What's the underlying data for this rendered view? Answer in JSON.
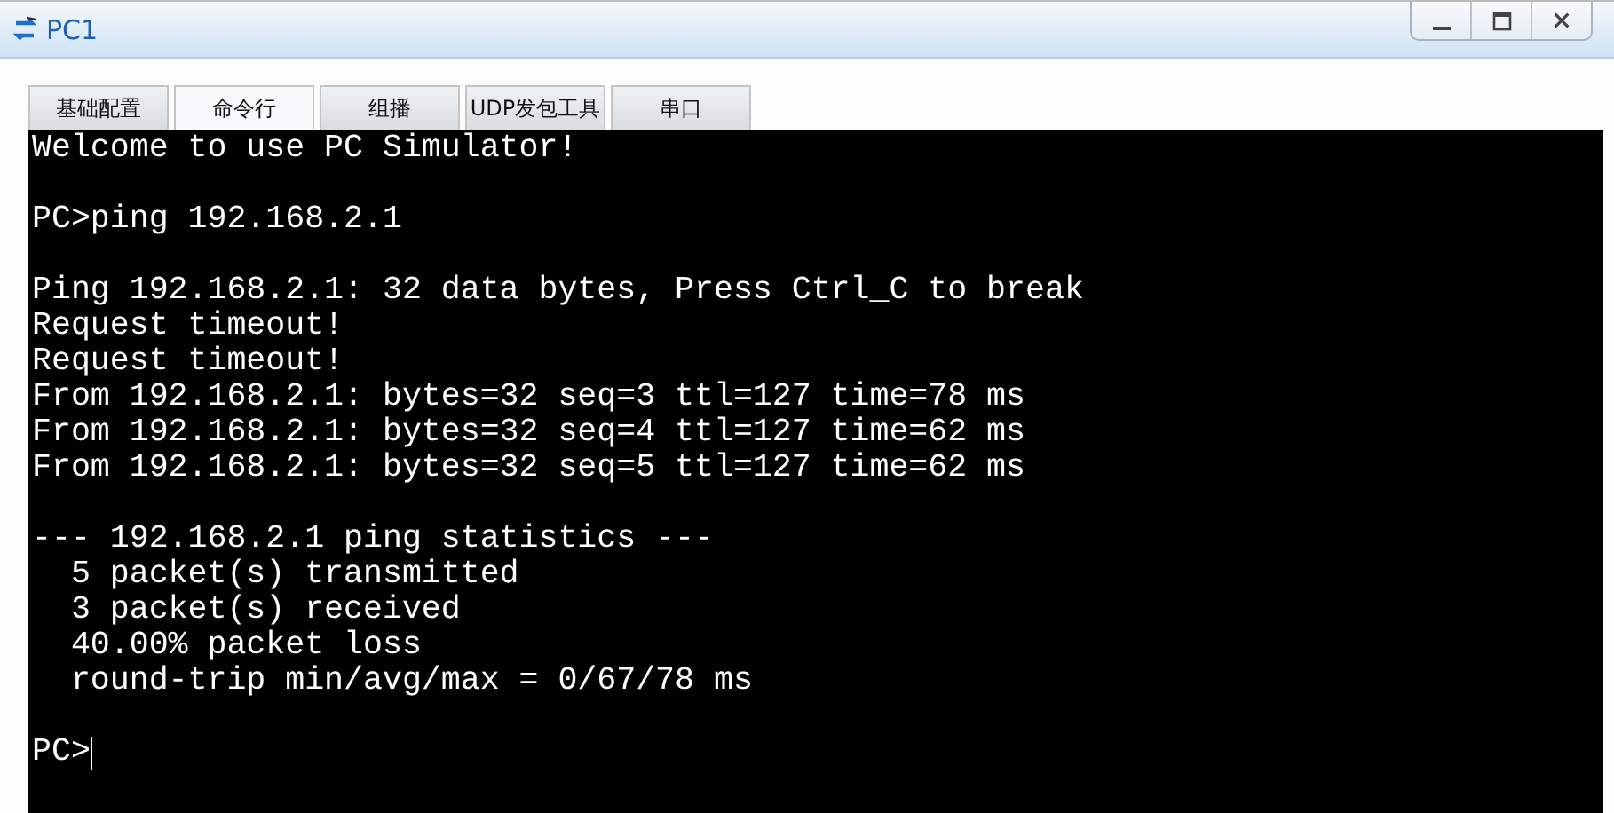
{
  "window": {
    "title": "PC1"
  },
  "tabs": [
    {
      "label": "基础配置",
      "selected": false
    },
    {
      "label": "命令行",
      "selected": true
    },
    {
      "label": "组播",
      "selected": false
    },
    {
      "label": "UDP发包工具",
      "selected": false
    },
    {
      "label": "串口",
      "selected": false
    }
  ],
  "terminal": {
    "blocks": [
      [
        "Welcome to use PC Simulator!"
      ],
      [
        "PC>ping 192.168.2.1"
      ],
      [
        "Ping 192.168.2.1: 32 data bytes, Press Ctrl_C to break",
        "Request timeout!",
        "Request timeout!",
        "From 192.168.2.1: bytes=32 seq=3 ttl=127 time=78 ms",
        "From 192.168.2.1: bytes=32 seq=4 ttl=127 time=62 ms",
        "From 192.168.2.1: bytes=32 seq=5 ttl=127 time=62 ms"
      ],
      [
        "--- 192.168.2.1 ping statistics ---",
        "  5 packet(s) transmitted",
        "  3 packet(s) received",
        "  40.00% packet loss",
        "  round-trip min/avg/max = 0/67/78 ms"
      ]
    ],
    "prompt": "PC>",
    "cursor": true
  }
}
